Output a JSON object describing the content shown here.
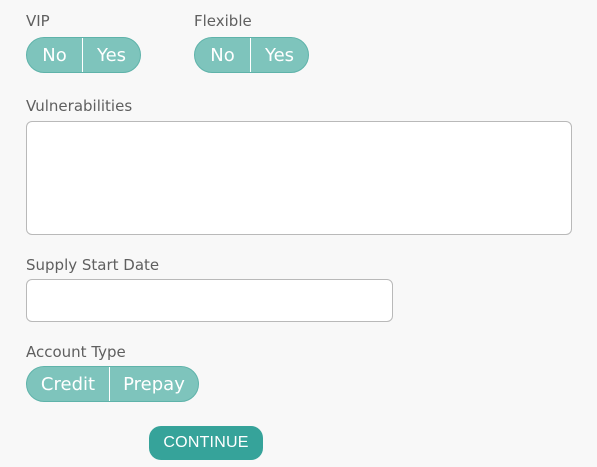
{
  "vip": {
    "label": "VIP",
    "options": [
      "No",
      "Yes"
    ]
  },
  "flexible": {
    "label": "Flexible",
    "options": [
      "No",
      "Yes"
    ]
  },
  "vulnerabilities": {
    "label": "Vulnerabilities",
    "value": ""
  },
  "supply_start_date": {
    "label": "Supply Start Date",
    "value": ""
  },
  "account_type": {
    "label": "Account Type",
    "options": [
      "Credit",
      "Prepay"
    ]
  },
  "continue_label": "CONTINUE",
  "colors": {
    "toggle_fill": "#7ec4bc",
    "toggle_border": "#5fb3aa",
    "button": "#36a39a",
    "background": "#f8f8f8"
  }
}
